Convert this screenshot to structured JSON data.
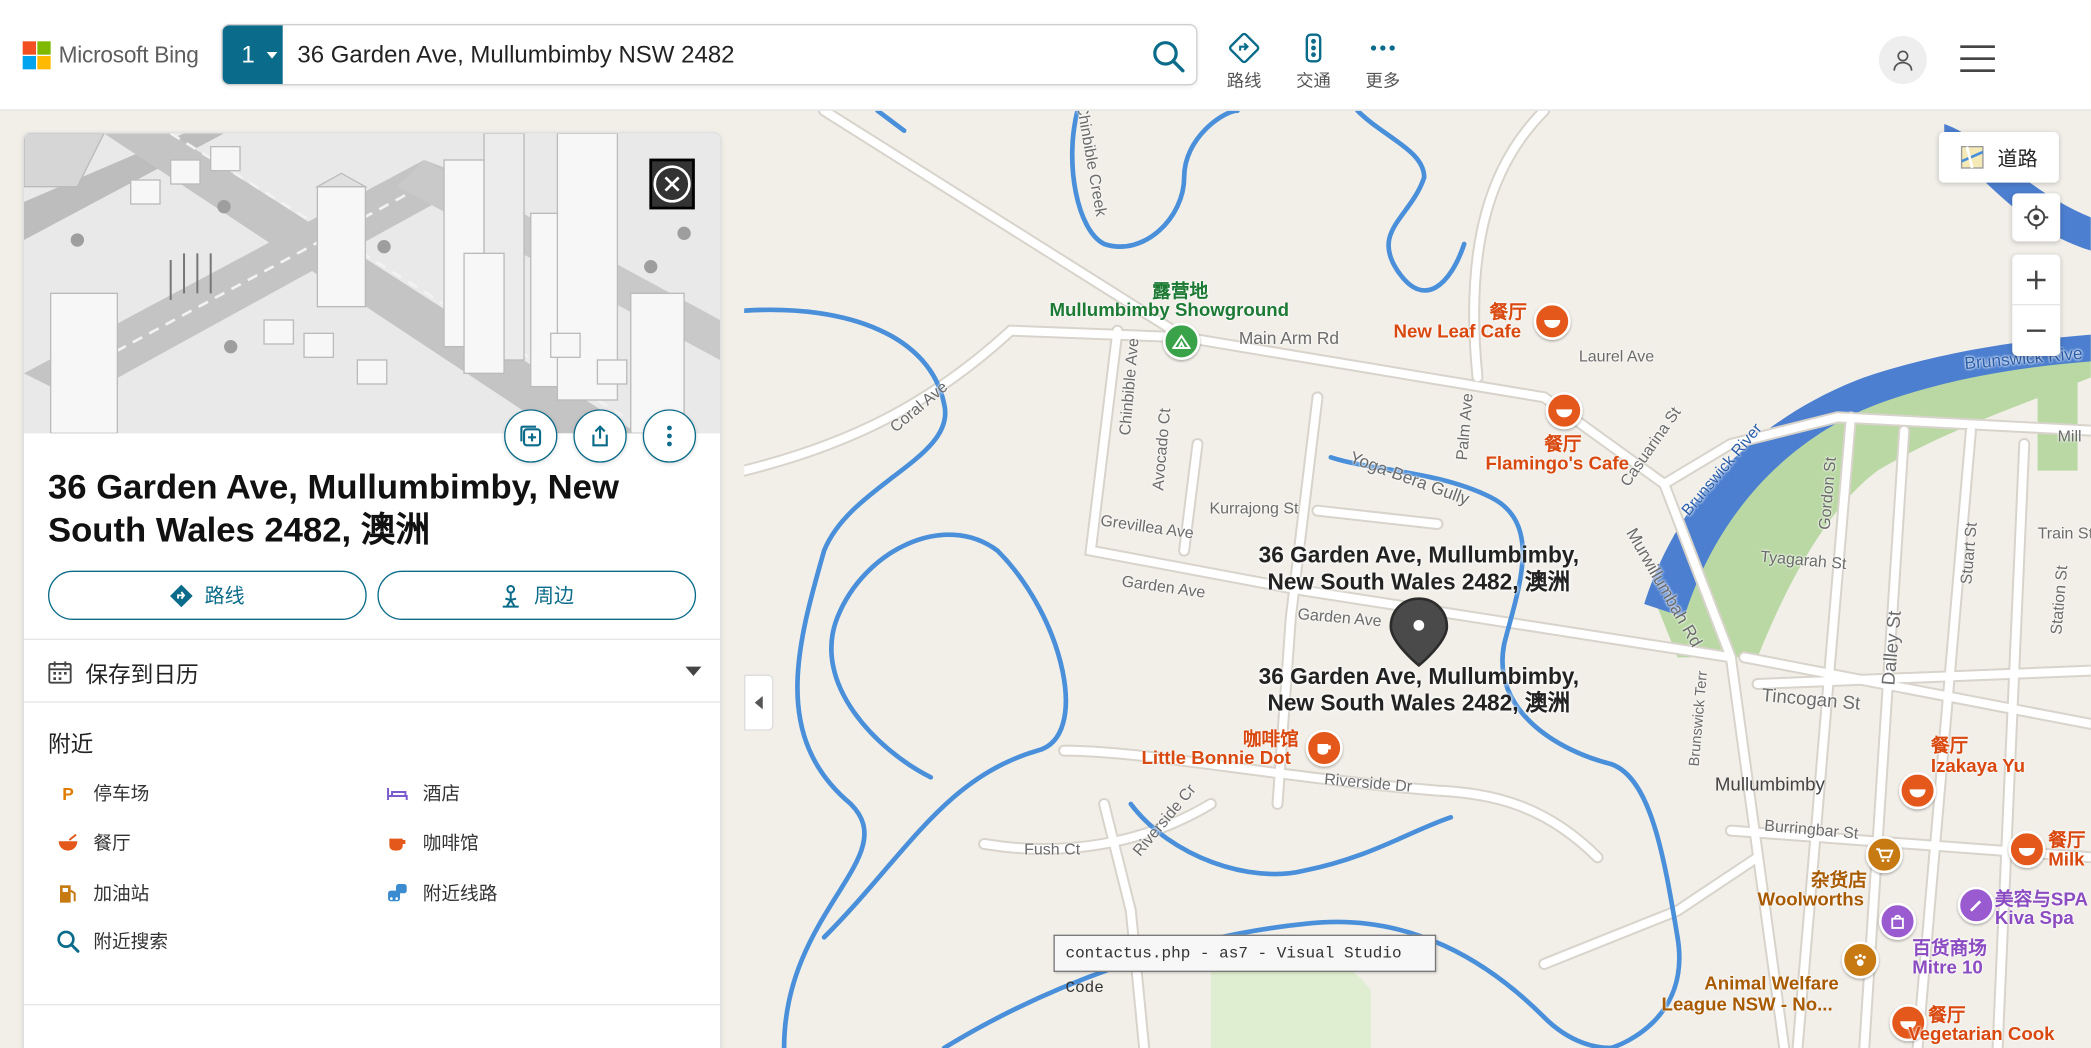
{
  "header": {
    "logo_text": "Microsoft Bing",
    "search_count": "1",
    "search_value": "36 Garden Ave, Mullumbimby NSW 2482",
    "nav": [
      {
        "label": "路线",
        "icon": "directions-icon"
      },
      {
        "label": "交通",
        "icon": "traffic-icon"
      },
      {
        "label": "更多",
        "icon": "more-icon"
      }
    ]
  },
  "panel": {
    "title": "36 Garden Ave, Mullumbimby, New South Wales 2482, 澳洲",
    "directions_label": "路线",
    "nearby_btn_label": "周边",
    "save_calendar_label": "保存到日历",
    "nearby_heading": "附近",
    "nearby_items": [
      "停车场",
      "酒店",
      "餐厅",
      "咖啡馆",
      "加油站",
      "附近线路",
      "附近搜索"
    ]
  },
  "map": {
    "style_button": "道路",
    "address_label": "36 Garden Ave, Mullumbimby, New South Wales 2482, 澳洲",
    "address_line1": "36 Garden Ave, Mullumbimby,",
    "address_line2": "New South Wales 2482, 澳洲",
    "pois": {
      "showground_cat": "露营地",
      "showground_name": "Mullumbimby Showground",
      "newleaf_cat": "餐厅",
      "newleaf_name": "New Leaf Cafe",
      "flamingo_cat": "餐厅",
      "flamingo_name": "Flamingo's Cafe",
      "bonnie_cat": "咖啡馆",
      "bonnie_name": "Little Bonnie Dot",
      "izakaya_cat": "餐厅",
      "izakaya_name": "Izakaya Yu",
      "milk_cat": "餐厅",
      "milk_name": "Milk",
      "woolworths_cat": "杂货店",
      "woolworths_name": "Woolworths",
      "mitre_cat": "百货商场",
      "mitre_name": "Mitre 10",
      "kiva_cat": "美容与SPA",
      "kiva_name": "Kiva Spa",
      "awl_name1": "Animal Welfare",
      "awl_name2": "League NSW - No...",
      "veg_cat": "餐厅",
      "veg_name": "Vegetarian Cook"
    },
    "streets": {
      "main_arm": "Main Arm Rd",
      "laurel": "Laurel Ave",
      "coral": "Coral Ave",
      "chinbible": "Chinbible Ave",
      "avocado": "Avocado Ct",
      "kurrajong": "Kurrajong St",
      "grevillea": "Grevillea Ave",
      "garden1": "Garden Ave",
      "garden2": "Garden Ave",
      "palm": "Palm Ave",
      "yoga": "Yoga-Bera Gully",
      "casuarina": "Casuarina St",
      "murwillumbah": "Murwillumbah Rd",
      "brunswick_river": "Brunswick River",
      "brunswick_river2": "Brunswick Rive",
      "gordon": "Gordon St",
      "tyagarah": "Tyagarah St",
      "stuart": "Stuart St",
      "dalley": "Dalley St",
      "tincogan": "Tincogan St",
      "brunswick_terr": "Brunswick Terr",
      "mullumbimby": "Mullumbimby",
      "burringbar": "Burringbar St",
      "riverside_dr": "Riverside Dr",
      "riverside_cr": "Riverside Cr",
      "fush": "Fush Ct",
      "creek": "Chinbible Creek",
      "train": "Train St",
      "station": "Station St",
      "mill": "Mill",
      "stuart2": "Stuart St"
    },
    "tooltip": "contactus.php - as7 - Visual Studio Code"
  },
  "colors": {
    "accent": "#0b6b8a",
    "river": "#4a8fd9",
    "river_wide": "#4c7fd0",
    "park": "#b9d8a3",
    "map_bg": "#f2efe9",
    "restaurant_pin": "#e4581c",
    "shop_pin": "#c77a12",
    "purple_pin": "#9a5bd0",
    "green_pin": "#3aa34a"
  }
}
